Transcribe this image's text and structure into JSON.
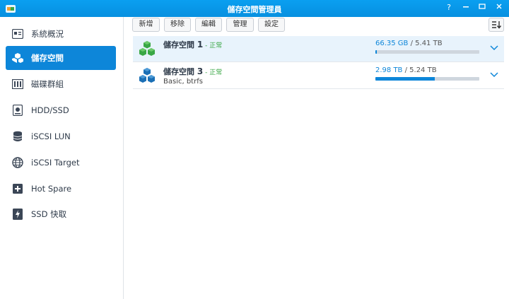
{
  "window": {
    "title": "儲存空間管理員",
    "help_label": "?"
  },
  "sidebar": {
    "items": [
      {
        "label": "系統概況",
        "icon": "overview-icon"
      },
      {
        "label": "儲存空間",
        "icon": "volume-icon"
      },
      {
        "label": "磁碟群組",
        "icon": "disk-group-icon"
      },
      {
        "label": "HDD/SSD",
        "icon": "hdd-icon"
      },
      {
        "label": "iSCSI LUN",
        "icon": "iscsi-lun-icon"
      },
      {
        "label": "iSCSI Target",
        "icon": "iscsi-target-icon"
      },
      {
        "label": "Hot Spare",
        "icon": "hot-spare-icon"
      },
      {
        "label": "SSD 快取",
        "icon": "ssd-cache-icon"
      }
    ],
    "active_index": 1
  },
  "toolbar": {
    "buttons": [
      "新增",
      "移除",
      "編輯",
      "管理",
      "設定"
    ]
  },
  "volumes": [
    {
      "name": "儲存空間",
      "number": "1",
      "separator": " - ",
      "status": "正常",
      "subtitle": "",
      "used": "66.35 GB",
      "total": " / 5.41 TB",
      "usage_fraction": 0.012,
      "color": "#3aa745"
    },
    {
      "name": "儲存空間",
      "number": "3",
      "separator": " - ",
      "status": "正常",
      "subtitle": "Basic, btrfs",
      "used": "2.98 TB",
      "total": " / 5.24 TB",
      "usage_fraction": 0.57,
      "color": "#1a6fb5"
    }
  ],
  "colors": {
    "accent": "#0d86d9",
    "status_ok": "#3aa745"
  }
}
